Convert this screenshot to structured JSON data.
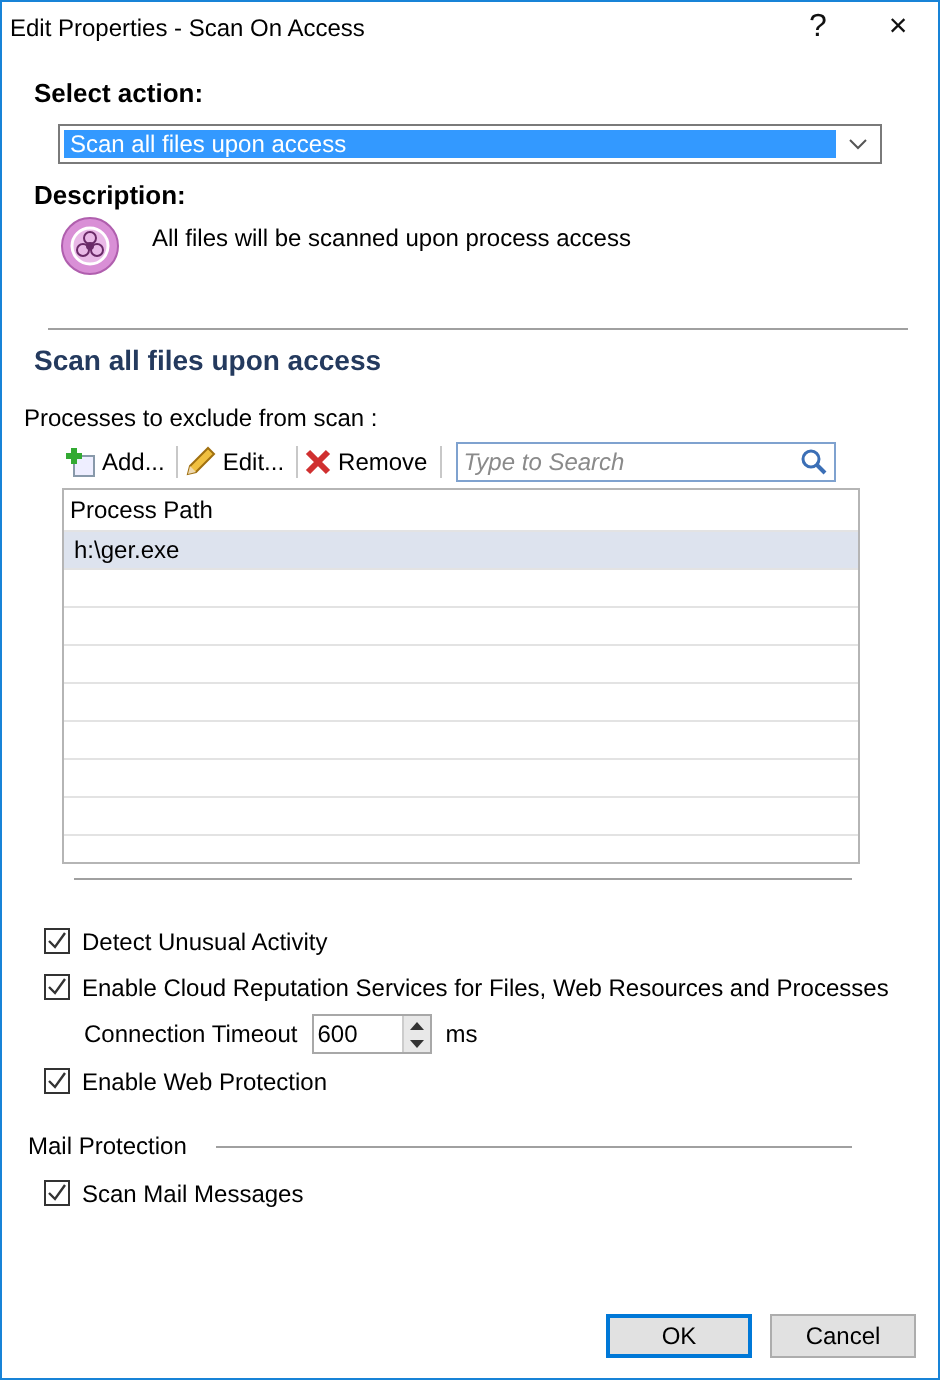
{
  "window": {
    "title": "Edit Properties - Scan On Access",
    "buttons": [
      "?",
      "×"
    ]
  },
  "action": {
    "label": "Select action:",
    "value": "Scan all files upon access"
  },
  "description": {
    "label": "Description:",
    "text": "All files will be scanned upon process access"
  },
  "section_title": "Scan all files upon access",
  "exclusions": {
    "label": "Processes to exclude from scan :",
    "toolbar": [
      {
        "kind": "add",
        "label": "Add..."
      },
      {
        "kind": "edit",
        "label": "Edit..."
      },
      {
        "kind": "remove",
        "label": "Remove"
      }
    ],
    "search": {
      "placeholder": "Type to Search"
    },
    "table": {
      "columns": [
        "Process Path"
      ],
      "rows": [
        {
          "path": "h:\\ger.exe",
          "selected": true
        }
      ]
    }
  },
  "options": [
    {
      "kind": "checkbox",
      "label": "Detect Unusual Activity",
      "checked": true
    },
    {
      "kind": "checkbox",
      "label": "Enable Cloud Reputation Services for Files, Web Resources and Processes",
      "checked": true
    },
    {
      "kind": "number",
      "label": "Connection Timeout",
      "value": "600",
      "unit": "ms"
    },
    {
      "kind": "checkbox",
      "label": "Enable Web Protection",
      "checked": true
    }
  ],
  "mail": {
    "label": "Mail Protection",
    "options": [
      {
        "kind": "checkbox",
        "label": "Scan Mail Messages",
        "checked": true
      }
    ]
  },
  "footer": [
    {
      "label": "OK",
      "default": true
    },
    {
      "label": "Cancel",
      "default": false
    }
  ]
}
